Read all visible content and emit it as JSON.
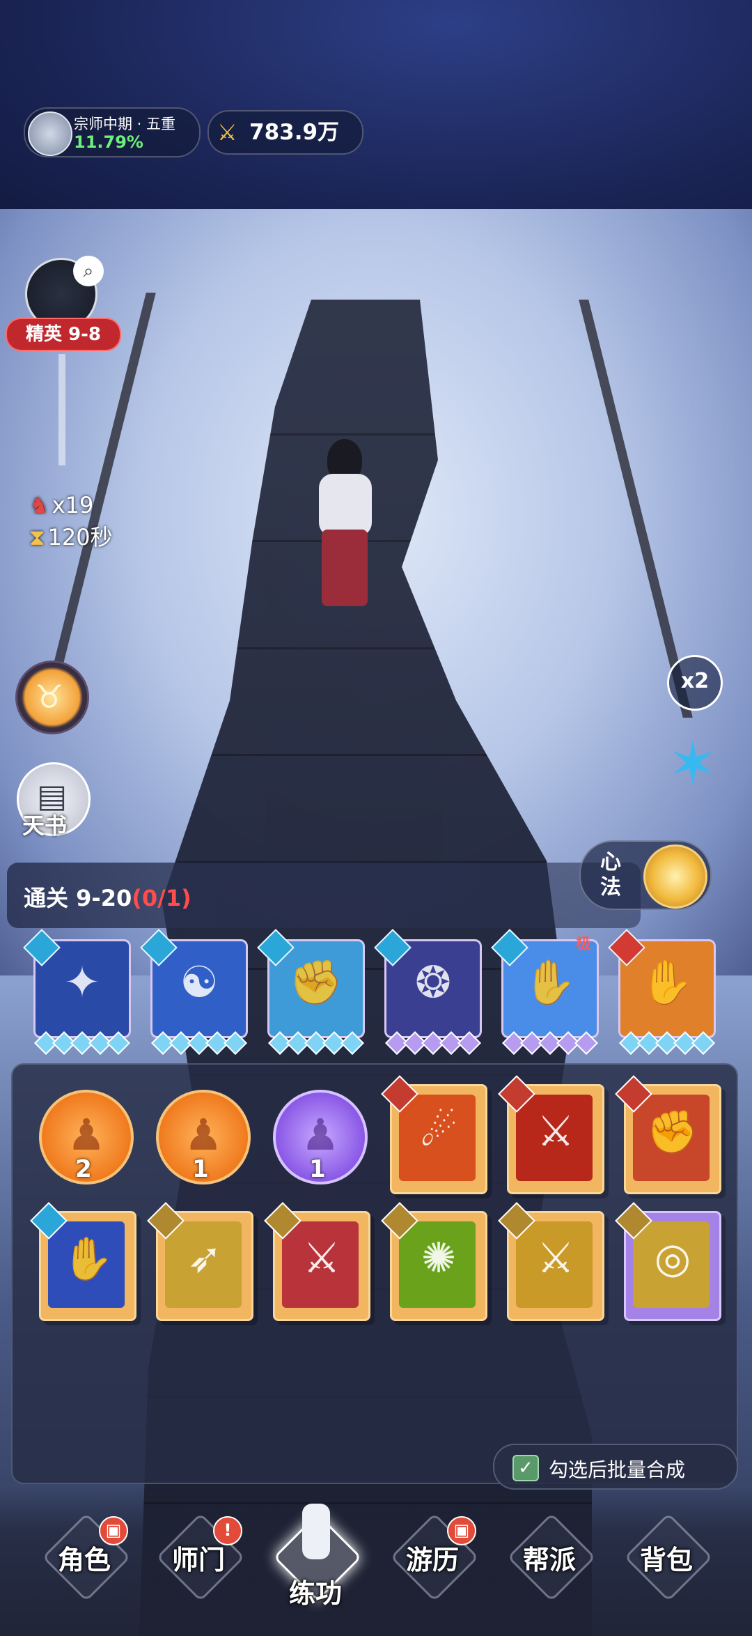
{
  "top": {
    "level": "宗师中期 · 五重",
    "exp": "11.79%",
    "power": "783.9万"
  },
  "stage": {
    "tag": "精英 9-8",
    "kills": "x19",
    "timer": "120秒",
    "book_label": "天书",
    "speed": "x2",
    "pass_text": "通关 9-20",
    "pass_progress": "(0/1)",
    "xinfa_label": "心法"
  },
  "equipped": [
    {
      "type": "water",
      "icon": "constellation-icon",
      "stars": 5,
      "color": "#2a4aa8"
    },
    {
      "type": "water",
      "icon": "bagua-palm-icon",
      "stars": 5,
      "color": "#2f5fc7"
    },
    {
      "type": "water",
      "icon": "fist-icon",
      "stars": 5,
      "color": "#3f9ad8"
    },
    {
      "type": "water",
      "icon": "orb-hands-icon",
      "stars": 5,
      "color": "#3b3f92"
    },
    {
      "type": "water",
      "icon": "palm-strike-icon",
      "stars": 5,
      "color": "#4a8de8",
      "badge": "极"
    },
    {
      "type": "fire",
      "icon": "flame-palm-icon",
      "stars": 5,
      "color": "#e0802a"
    }
  ],
  "inventory": {
    "row1_orbs": [
      {
        "count": "2",
        "color": "orange"
      },
      {
        "count": "1",
        "color": "orange"
      },
      {
        "count": "1",
        "color": "violet"
      }
    ],
    "row1_cards": [
      {
        "icon": "fireball-icon",
        "type": "fire",
        "art": "#d8501e"
      },
      {
        "icon": "red-blade-icon",
        "type": "fire",
        "art": "#b8281a"
      },
      {
        "icon": "fist-icon",
        "type": "fire",
        "art": "#c8462a"
      }
    ],
    "row2_cards": [
      {
        "icon": "ice-claw-icon",
        "type": "water",
        "art": "#2e4db8",
        "frame": "orange"
      },
      {
        "icon": "golden-arrow-icon",
        "type": "gold",
        "art": "#c9a234",
        "frame": "orange"
      },
      {
        "icon": "red-swords-icon",
        "type": "gold",
        "art": "#b8343a",
        "frame": "orange"
      },
      {
        "icon": "green-vortex-icon",
        "type": "gold",
        "art": "#6aa21c",
        "frame": "orange"
      },
      {
        "icon": "golden-blades-icon",
        "type": "gold",
        "art": "#c99a28",
        "frame": "orange"
      },
      {
        "icon": "golden-ring-icon",
        "type": "gold",
        "art": "#c9a234",
        "frame": "purple"
      }
    ]
  },
  "batch_label": "勾选后批量合成",
  "nav": [
    {
      "label": "角色",
      "badge": "gift"
    },
    {
      "label": "师门",
      "badge": "alert"
    },
    {
      "label": "练功",
      "active": true
    },
    {
      "label": "游历",
      "badge": "gift"
    },
    {
      "label": "帮派"
    },
    {
      "label": "背包"
    }
  ]
}
